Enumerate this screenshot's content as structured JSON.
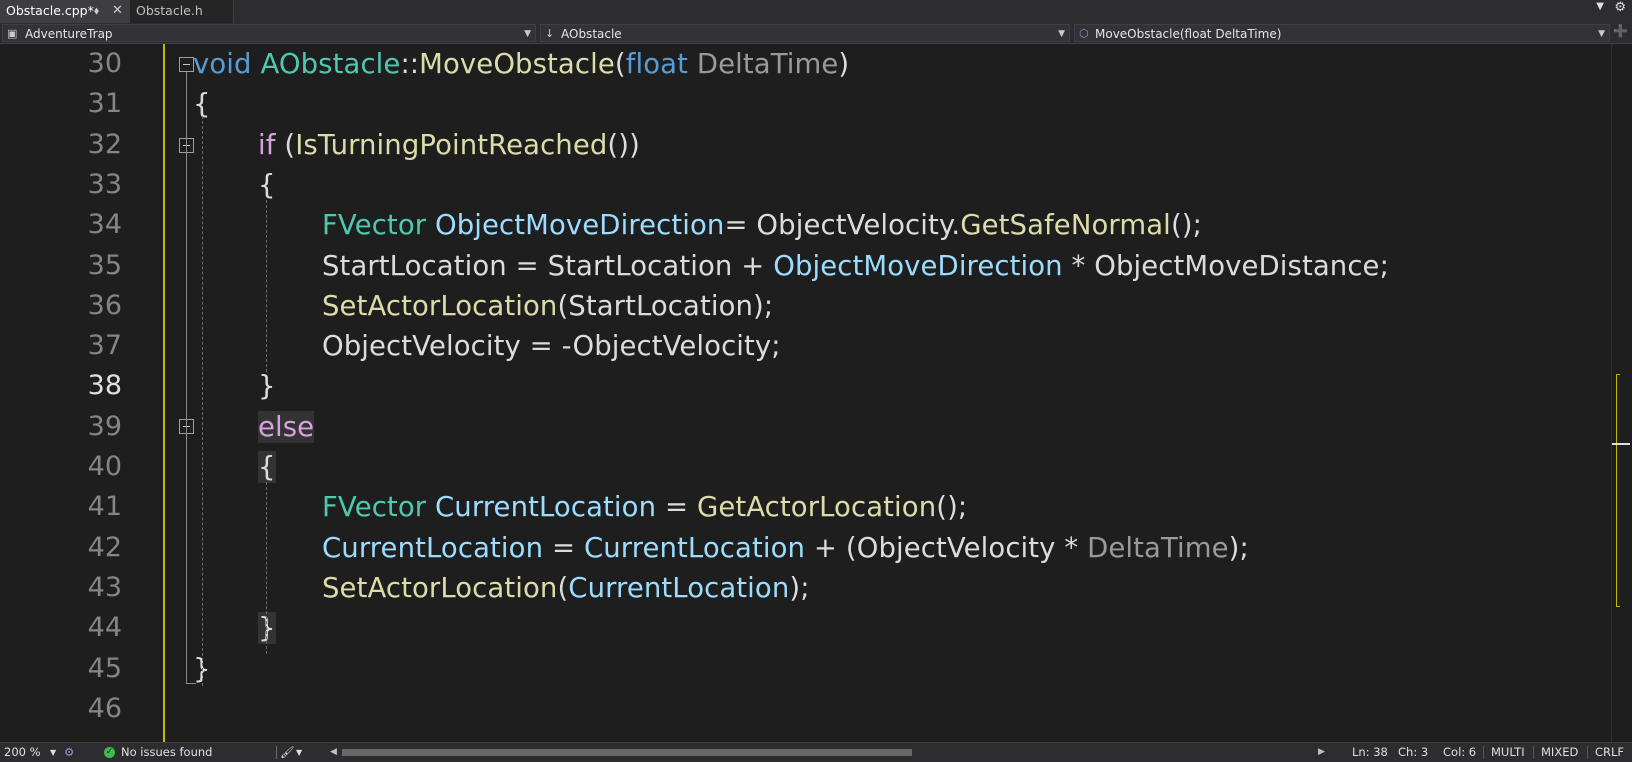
{
  "tabs": [
    {
      "label": "Obstacle.cpp*",
      "active": true
    },
    {
      "label": "Obstacle.h",
      "active": false
    }
  ],
  "tab_icons": {
    "pin": "pin-icon",
    "close": "close-icon",
    "dropdown": "chevron-down-icon",
    "settings": "gear-icon"
  },
  "navbar": {
    "project": "AdventureTrap",
    "class": "AObstacle",
    "member": "MoveObstacle(float DeltaTime)"
  },
  "editor": {
    "current_line": 38,
    "lines": [
      {
        "num": "30",
        "tokens": [
          [
            "kw",
            "void"
          ],
          [
            "plain",
            " "
          ],
          [
            "type",
            "AObstacle"
          ],
          [
            "plain",
            "::"
          ],
          [
            "fn",
            "MoveObstacle"
          ],
          [
            "plain",
            "("
          ],
          [
            "kw",
            "float"
          ],
          [
            "plain",
            " "
          ],
          [
            "param",
            "DeltaTime"
          ],
          [
            "plain",
            ")"
          ]
        ]
      },
      {
        "num": "31",
        "tokens": [
          [
            "plain",
            "{"
          ]
        ]
      },
      {
        "num": "32",
        "tokens": [
          [
            "kw2",
            "if"
          ],
          [
            "plain",
            " ("
          ],
          [
            "fn",
            "IsTurningPointReached"
          ],
          [
            "plain",
            "())"
          ]
        ]
      },
      {
        "num": "33",
        "tokens": [
          [
            "plain",
            "{"
          ]
        ]
      },
      {
        "num": "34",
        "tokens": [
          [
            "type",
            "FVector"
          ],
          [
            "plain",
            " "
          ],
          [
            "var",
            "ObjectMoveDirection"
          ],
          [
            "plain",
            "= ObjectVelocity."
          ],
          [
            "fn",
            "GetSafeNormal"
          ],
          [
            "plain",
            "();"
          ]
        ]
      },
      {
        "num": "35",
        "tokens": [
          [
            "plain",
            "StartLocation = StartLocation + "
          ],
          [
            "var",
            "ObjectMoveDirection"
          ],
          [
            "plain",
            " * ObjectMoveDistance;"
          ]
        ]
      },
      {
        "num": "36",
        "tokens": [
          [
            "fn",
            "SetActorLocation"
          ],
          [
            "plain",
            "(StartLocation);"
          ]
        ]
      },
      {
        "num": "37",
        "tokens": [
          [
            "plain",
            "ObjectVelocity = -ObjectVelocity;"
          ]
        ]
      },
      {
        "num": "38",
        "tokens": [
          [
            "plain",
            "}"
          ]
        ]
      },
      {
        "num": "39",
        "tokens": [
          [
            "kw2",
            "else"
          ]
        ]
      },
      {
        "num": "40",
        "tokens": [
          [
            "plain",
            "{"
          ]
        ]
      },
      {
        "num": "41",
        "tokens": [
          [
            "type",
            "FVector"
          ],
          [
            "plain",
            " "
          ],
          [
            "var",
            "CurrentLocation"
          ],
          [
            "plain",
            " = "
          ],
          [
            "fn",
            "GetActorLocation"
          ],
          [
            "plain",
            "();"
          ]
        ]
      },
      {
        "num": "42",
        "tokens": [
          [
            "var",
            "CurrentLocation"
          ],
          [
            "plain",
            " = "
          ],
          [
            "var",
            "CurrentLocation"
          ],
          [
            "plain",
            " + (ObjectVelocity * "
          ],
          [
            "param",
            "DeltaTime"
          ],
          [
            "plain",
            ");"
          ]
        ]
      },
      {
        "num": "43",
        "tokens": [
          [
            "fn",
            "SetActorLocation"
          ],
          [
            "plain",
            "("
          ],
          [
            "var",
            "CurrentLocation"
          ],
          [
            "plain",
            ");"
          ]
        ]
      },
      {
        "num": "44",
        "tokens": [
          [
            "plain",
            "}"
          ]
        ]
      },
      {
        "num": "45",
        "tokens": [
          [
            "plain",
            "}"
          ]
        ]
      },
      {
        "num": "46",
        "tokens": []
      }
    ]
  },
  "statusbar": {
    "zoom": "200 %",
    "issues": "No issues found",
    "ln": "Ln: 38",
    "ch": "Ch: 3",
    "col": "Col: 6",
    "multi": "MULTI",
    "mixed": "MIXED",
    "crlf": "CRLF"
  }
}
